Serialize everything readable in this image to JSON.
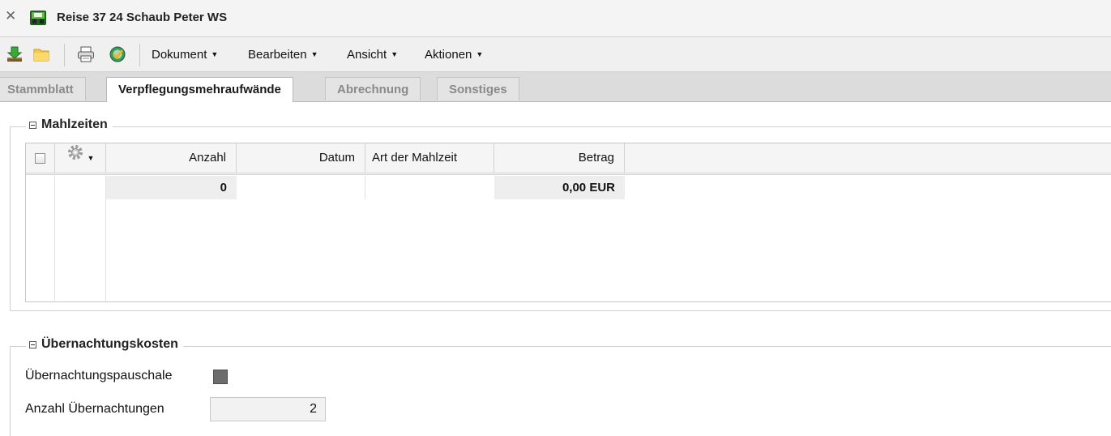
{
  "window": {
    "title": "Reise 37 24 Schaub Peter WS",
    "close_icon": "close-icon",
    "app_icon": "travel-document-icon"
  },
  "toolbar": {
    "icons": [
      "download-icon",
      "folder-icon",
      "print-icon",
      "check-globe-icon"
    ],
    "menus": [
      {
        "label": "Dokument"
      },
      {
        "label": "Bearbeiten"
      },
      {
        "label": "Ansicht"
      },
      {
        "label": "Aktionen"
      }
    ]
  },
  "tabs": [
    {
      "label": "Stammblatt",
      "active": false
    },
    {
      "label": "Verpflegungsmehraufwände",
      "active": true
    },
    {
      "label": "Abrechnung",
      "active": false
    },
    {
      "label": "Sonstiges",
      "active": false
    }
  ],
  "meals": {
    "legend": "Mahlzeiten",
    "columns": [
      "Anzahl",
      "Datum",
      "Art der Mahlzeit",
      "Betrag"
    ],
    "summary": {
      "anzahl": "0",
      "betrag": "0,00 EUR"
    }
  },
  "overnight": {
    "legend": "Übernachtungskosten",
    "pauschale_label": "Übernachtungspauschale",
    "pauschale_checked": true,
    "count_label": "Anzahl Übernachtungen",
    "count_value": "2"
  },
  "colors": {
    "tab_active_bg": "#ffffff",
    "tab_inactive_text": "#8a8a8a",
    "checkbox_checked": "#6d6d6d"
  }
}
